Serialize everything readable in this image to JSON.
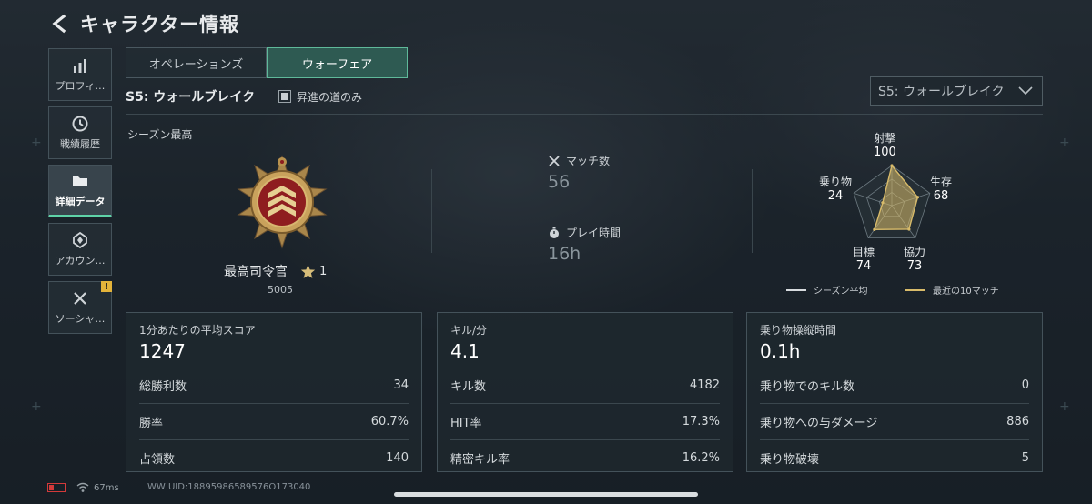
{
  "header": {
    "title": "キャラクター情報"
  },
  "sidebar": {
    "items": [
      {
        "label": "プロフィ…",
        "icon": "bar-chart-icon",
        "active": false
      },
      {
        "label": "戦績履歴",
        "icon": "history-icon",
        "active": false
      },
      {
        "label": "詳細データ",
        "icon": "folder-icon",
        "active": true
      },
      {
        "label": "アカウン…",
        "icon": "account-icon",
        "active": false
      },
      {
        "label": "ソーシャ…",
        "icon": "tools-icon",
        "active": false,
        "badge": "!"
      }
    ]
  },
  "tabs": [
    {
      "label": "オペレーションズ",
      "active": false
    },
    {
      "label": "ウォーフェア",
      "active": true
    }
  ],
  "season": {
    "label": "S5: ウォールブレイク",
    "checkbox_label": "昇進の道のみ",
    "checkbox_checked": true,
    "select_value": "S5: ウォールブレイク"
  },
  "season_best": {
    "title": "シーズン最高",
    "rank_name": "最高司令官",
    "rank_stars": "1",
    "rank_points": "5005",
    "matches_label": "マッチ数",
    "matches_value": "56",
    "playtime_label": "プレイ時間",
    "playtime_value": "16h"
  },
  "radar": {
    "axes": [
      {
        "name": "射撃",
        "value": "100"
      },
      {
        "name": "生存",
        "value": "68"
      },
      {
        "name": "協力",
        "value": "73"
      },
      {
        "name": "目標",
        "value": "74"
      },
      {
        "name": "乗り物",
        "value": "24"
      }
    ],
    "values": [
      100,
      68,
      73,
      74,
      24
    ],
    "legend_season_avg": "シーズン平均",
    "legend_recent": "最近の10マッチ",
    "avg_color": "#d7dbde",
    "recent_color": "#d8bb6a"
  },
  "panels": [
    {
      "head": "1分あたりの平均スコア",
      "big": "1247",
      "rows": [
        {
          "label": "総勝利数",
          "value": "34"
        },
        {
          "label": "勝率",
          "value": "60.7%"
        },
        {
          "label": "占領数",
          "value": "140"
        }
      ]
    },
    {
      "head": "キル/分",
      "big": "4.1",
      "rows": [
        {
          "label": "キル数",
          "value": "4182"
        },
        {
          "label": "HIT率",
          "value": "17.3%"
        },
        {
          "label": "精密キル率",
          "value": "16.2%"
        }
      ]
    },
    {
      "head": "乗り物操縦時間",
      "big": "0.1h",
      "rows": [
        {
          "label": "乗り物でのキル数",
          "value": "0"
        },
        {
          "label": "乗り物への与ダメージ",
          "value": "886"
        },
        {
          "label": "乗り物破壊",
          "value": "5"
        }
      ]
    }
  ],
  "footer": {
    "ping": "67ms",
    "uid": "WW UID:18895986589576O173040"
  }
}
